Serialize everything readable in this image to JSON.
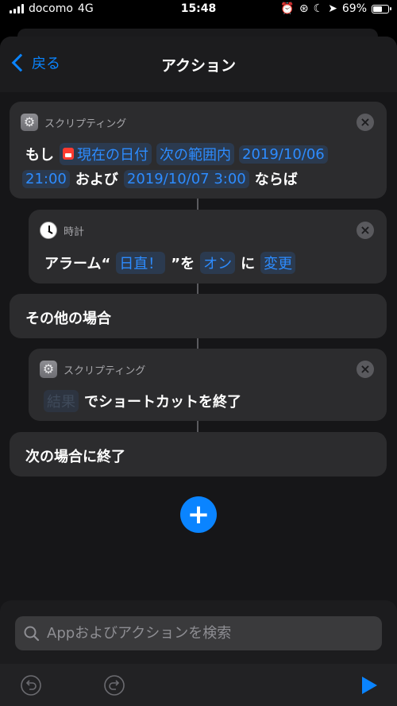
{
  "status": {
    "carrier": "docomo",
    "network": "4G",
    "time": "15:48",
    "battery": "69%",
    "battery_fraction": 0.69
  },
  "nav": {
    "back_label": "戻る",
    "title": "アクション"
  },
  "actions": {
    "if": {
      "category": "スクリプティング",
      "t1": "もし",
      "date_token": "現在の日付",
      "cond_token": "次の範囲内",
      "start_a": "2019/10/06",
      "start_b": "21:00",
      "and_word": "および",
      "end_token": "2019/10/07 3:00",
      "then_word": "ならば"
    },
    "alarm": {
      "category": "時計",
      "t1": "アラーム“",
      "name_token": "日直！",
      "t2": "”を",
      "state_token": "オン",
      "t3": "に",
      "change_token": "変更"
    },
    "otherwise": {
      "label": "その他の場合"
    },
    "exit": {
      "category": "スクリプティング",
      "result_token": "結果",
      "text": "でショートカットを終了"
    },
    "endif": {
      "label": "次の場合に終了"
    }
  },
  "search": {
    "placeholder": "Appおよびアクションを検索"
  },
  "colors": {
    "accent": "#0a84ff",
    "card": "#2c2c2e",
    "background": "#000000"
  }
}
